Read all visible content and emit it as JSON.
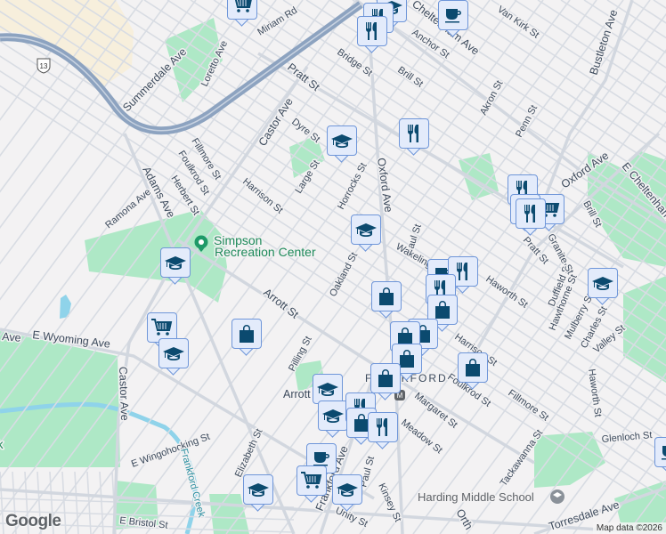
{
  "map": {
    "attribution": "Map data ©2026",
    "logo": "Google",
    "route_shield": "13",
    "poi": {
      "simpson": "Simpson",
      "simpson2": "Recreation Center",
      "harding": "Harding Middle School",
      "frankford": "FRANKFORD",
      "park_fragment": "rk"
    },
    "streets": [
      "Miriam Rd",
      "Summerdale Ave",
      "Loretto Ave",
      "Pratt St",
      "Castor Ave",
      "Dyre St",
      "Fillmore St",
      "Foulkrod St",
      "Herbert St",
      "Adams Ave",
      "Ramona Ave",
      "Harrison St",
      "Large St",
      "Horrocks St",
      "Oxford Ave",
      "Bridge St",
      "Anchor St",
      "Brill St",
      "Van Kirk St",
      "Cheltenham Ave",
      "Akron St",
      "Penn St",
      "Bustleton Ave",
      "E Cheltenham Ave",
      "Saul St",
      "Wakeling St",
      "Oakland St",
      "Arrott St",
      "Pilling St",
      "E Wyoming Ave",
      "Castor Ave",
      "E Wingohocking St",
      "Frankford Creek",
      "Elizabeth St",
      "E Bristol St",
      "Haworth St",
      "Duffield St",
      "Hawthorne St",
      "Mulberry St",
      "Charles St",
      "Valley St",
      "Margaret St",
      "Meadow St",
      "Tackawanna St",
      "Glenloch St",
      "Torresdale Ave",
      "Kinsey St",
      "Paul St",
      "Unity St",
      "Frankford Ave",
      "Granite St",
      "Brill St",
      "Oxford Ave",
      "Haworth St",
      "Pratt St",
      "Fillmore St",
      "Foulkrod St",
      "Harrison St",
      "Arrott",
      "Ave",
      "Orth"
    ],
    "markers": [
      {
        "type": "grocery",
        "label": "Grocery store"
      },
      {
        "type": "school",
        "label": "School"
      },
      {
        "type": "restaurant",
        "label": "Restaurant"
      },
      {
        "type": "restaurant",
        "label": "Restaurant"
      },
      {
        "type": "cafe",
        "label": "Cafe"
      },
      {
        "type": "school",
        "label": "School"
      },
      {
        "type": "restaurant",
        "label": "Restaurant"
      },
      {
        "type": "school",
        "label": "School"
      },
      {
        "type": "restaurant",
        "label": "Restaurant"
      },
      {
        "type": "grocery",
        "label": "Grocery store"
      },
      {
        "type": "restaurant",
        "label": "Restaurant"
      },
      {
        "type": "restaurant",
        "label": "Restaurant"
      },
      {
        "type": "school",
        "label": "School"
      },
      {
        "type": "shopping",
        "label": "Shopping"
      },
      {
        "type": "cafe",
        "label": "Cafe"
      },
      {
        "type": "restaurant",
        "label": "Restaurant"
      },
      {
        "type": "restaurant",
        "label": "Restaurant"
      },
      {
        "type": "shopping",
        "label": "Shopping"
      },
      {
        "type": "shopping",
        "label": "Shopping"
      },
      {
        "type": "shopping",
        "label": "Shopping"
      },
      {
        "type": "shopping",
        "label": "Shopping"
      },
      {
        "type": "shopping",
        "label": "Shopping"
      },
      {
        "type": "shopping",
        "label": "Shopping"
      },
      {
        "type": "grocery",
        "label": "Grocery store"
      },
      {
        "type": "school",
        "label": "School"
      },
      {
        "type": "shopping",
        "label": "Shopping"
      },
      {
        "type": "school",
        "label": "School"
      },
      {
        "type": "school",
        "label": "School"
      },
      {
        "type": "school",
        "label": "School"
      },
      {
        "type": "restaurant",
        "label": "Restaurant"
      },
      {
        "type": "shopping",
        "label": "Shopping"
      },
      {
        "type": "restaurant",
        "label": "Restaurant"
      },
      {
        "type": "cafe",
        "label": "Cafe"
      },
      {
        "type": "grocery",
        "label": "Grocery store"
      },
      {
        "type": "school",
        "label": "School"
      },
      {
        "type": "school",
        "label": "School"
      },
      {
        "type": "cafe",
        "label": "Cafe"
      }
    ]
  },
  "colors": {
    "marker_icon": "#0b4a6f",
    "marker_bg": "#e3ebfb",
    "park": "#a8e6c1",
    "water": "#8fd3ea",
    "highway": "#8da3c0",
    "beige": "#f7efdc"
  }
}
